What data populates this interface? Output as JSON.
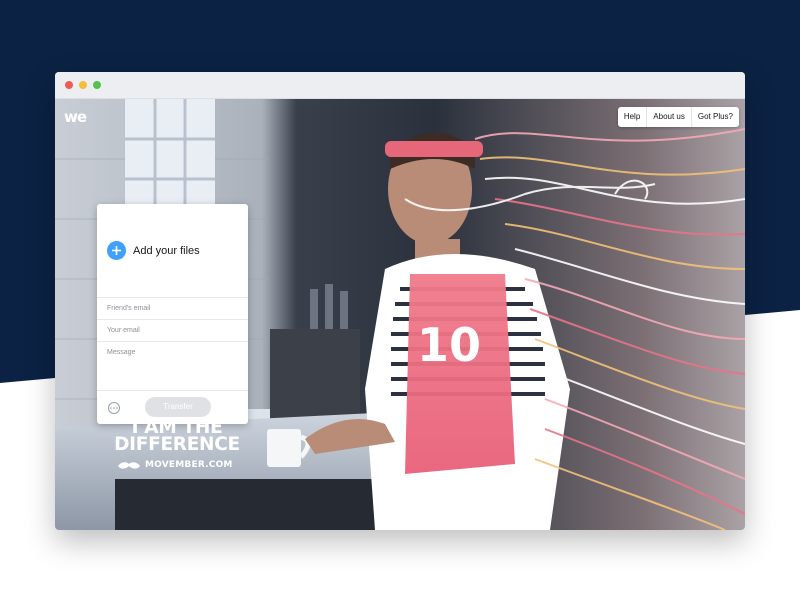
{
  "colors": {
    "backdrop_navy": "#0b2244",
    "accent_blue": "#409fff",
    "panel_white": "#ffffff",
    "transfer_disabled": "#dfe1e4"
  },
  "window": {
    "controls": [
      "close",
      "minimize",
      "maximize"
    ]
  },
  "header": {
    "logo_text": "we",
    "nav": [
      {
        "label": "Help"
      },
      {
        "label": "About us"
      },
      {
        "label": "Got Plus?"
      }
    ]
  },
  "upload_panel": {
    "add_files_label": "Add your files",
    "add_icon": "plus-circle-icon",
    "friends_email_placeholder": "Friend's email",
    "your_email_placeholder": "Your email",
    "message_placeholder": "Message",
    "more_icon": "ellipsis-circle-icon",
    "transfer_label": "Transfer"
  },
  "campaign": {
    "headline_line1": "I AM THE",
    "headline_line2": "DIFFERENCE",
    "brand_icon": "mustache-icon",
    "brand_url": "MOVEMBER.COM"
  },
  "background_image": {
    "subject": "man-with-headband-holding-mug-in-kitchen"
  }
}
